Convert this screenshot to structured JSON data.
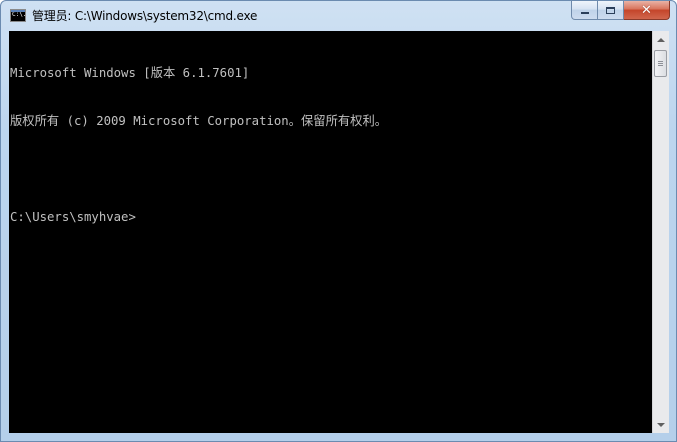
{
  "window": {
    "title": "管理员: C:\\Windows\\system32\\cmd.exe",
    "app_icon_text": "C:\\."
  },
  "caption_buttons": {
    "minimize_label": "",
    "maximize_label": "",
    "close_label": "✕"
  },
  "console": {
    "lines": [
      "Microsoft Windows [版本 6.1.7601]",
      "版权所有 (c) 2009 Microsoft Corporation。保留所有权利。",
      "",
      "C:\\Users\\smyhvae>"
    ],
    "foreground_color": "#c0c0c0",
    "background_color": "#000000"
  },
  "icons": {
    "app": "cmd-icon",
    "minimize": "minimize-icon",
    "maximize": "maximize-icon",
    "close": "close-icon",
    "scroll_up": "chevron-up-icon",
    "scroll_down": "chevron-down-icon"
  },
  "scrollbar": {
    "position_fraction": 0.0
  }
}
